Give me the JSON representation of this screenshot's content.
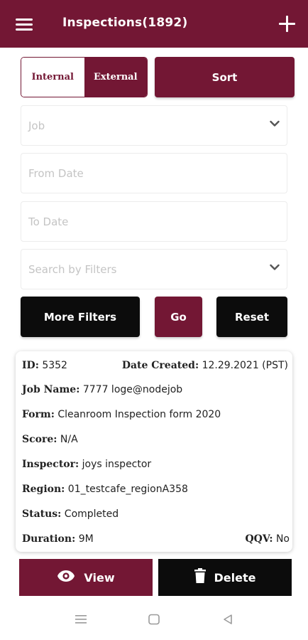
{
  "header": {
    "title": "Inspections(1892)",
    "menu_icon": "hamburger-menu-icon",
    "add_icon": "plus-icon"
  },
  "tabs": {
    "internal": "Internal",
    "external": "External",
    "selected": "Internal"
  },
  "sort_label": "Sort",
  "filters": {
    "job_placeholder": "Job",
    "from_date_placeholder": "From Date",
    "to_date_placeholder": "To Date",
    "search_placeholder": "Search by Filters"
  },
  "buttons": {
    "more_filters": "More  Filters",
    "go": "Go",
    "reset": "Reset"
  },
  "inspection": {
    "id_label": "ID:",
    "id": "5352",
    "date_created_label": "Date  Created:",
    "date_created": "12.29.2021 (PST)",
    "job_name_label": "Job  Name:",
    "job_name": "7777 loge@nodejob",
    "form_label": "Form:",
    "form": "Cleanroom Inspection form 2020",
    "score_label": "Score:",
    "score": "N/A",
    "inspector_label": "Inspector:",
    "inspector": "joys inspector",
    "region_label": "Region:",
    "region": "01_testcafe_regionA358",
    "status_label": "Status:",
    "status": "Completed",
    "duration_label": "Duration:",
    "duration": "9M",
    "qqv_label": "QQV:",
    "qqv": "No"
  },
  "actions": {
    "view": "View",
    "delete": "Delete"
  },
  "colors": {
    "primary": "#731734",
    "dark": "#0c0c0c",
    "placeholder": "#c4c4c4"
  }
}
